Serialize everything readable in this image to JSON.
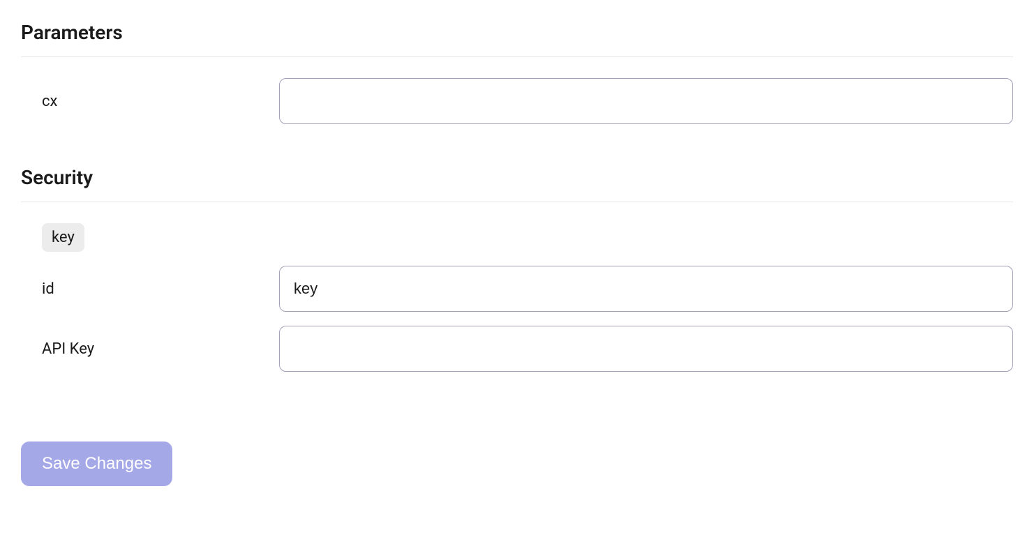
{
  "parameters": {
    "title": "Parameters",
    "fields": {
      "cx": {
        "label": "cx",
        "value": ""
      }
    }
  },
  "security": {
    "title": "Security",
    "badge": "key",
    "fields": {
      "id": {
        "label": "id",
        "value": "key"
      },
      "apiKey": {
        "label": "API Key",
        "value": ""
      }
    }
  },
  "actions": {
    "save_label": "Save Changes"
  }
}
